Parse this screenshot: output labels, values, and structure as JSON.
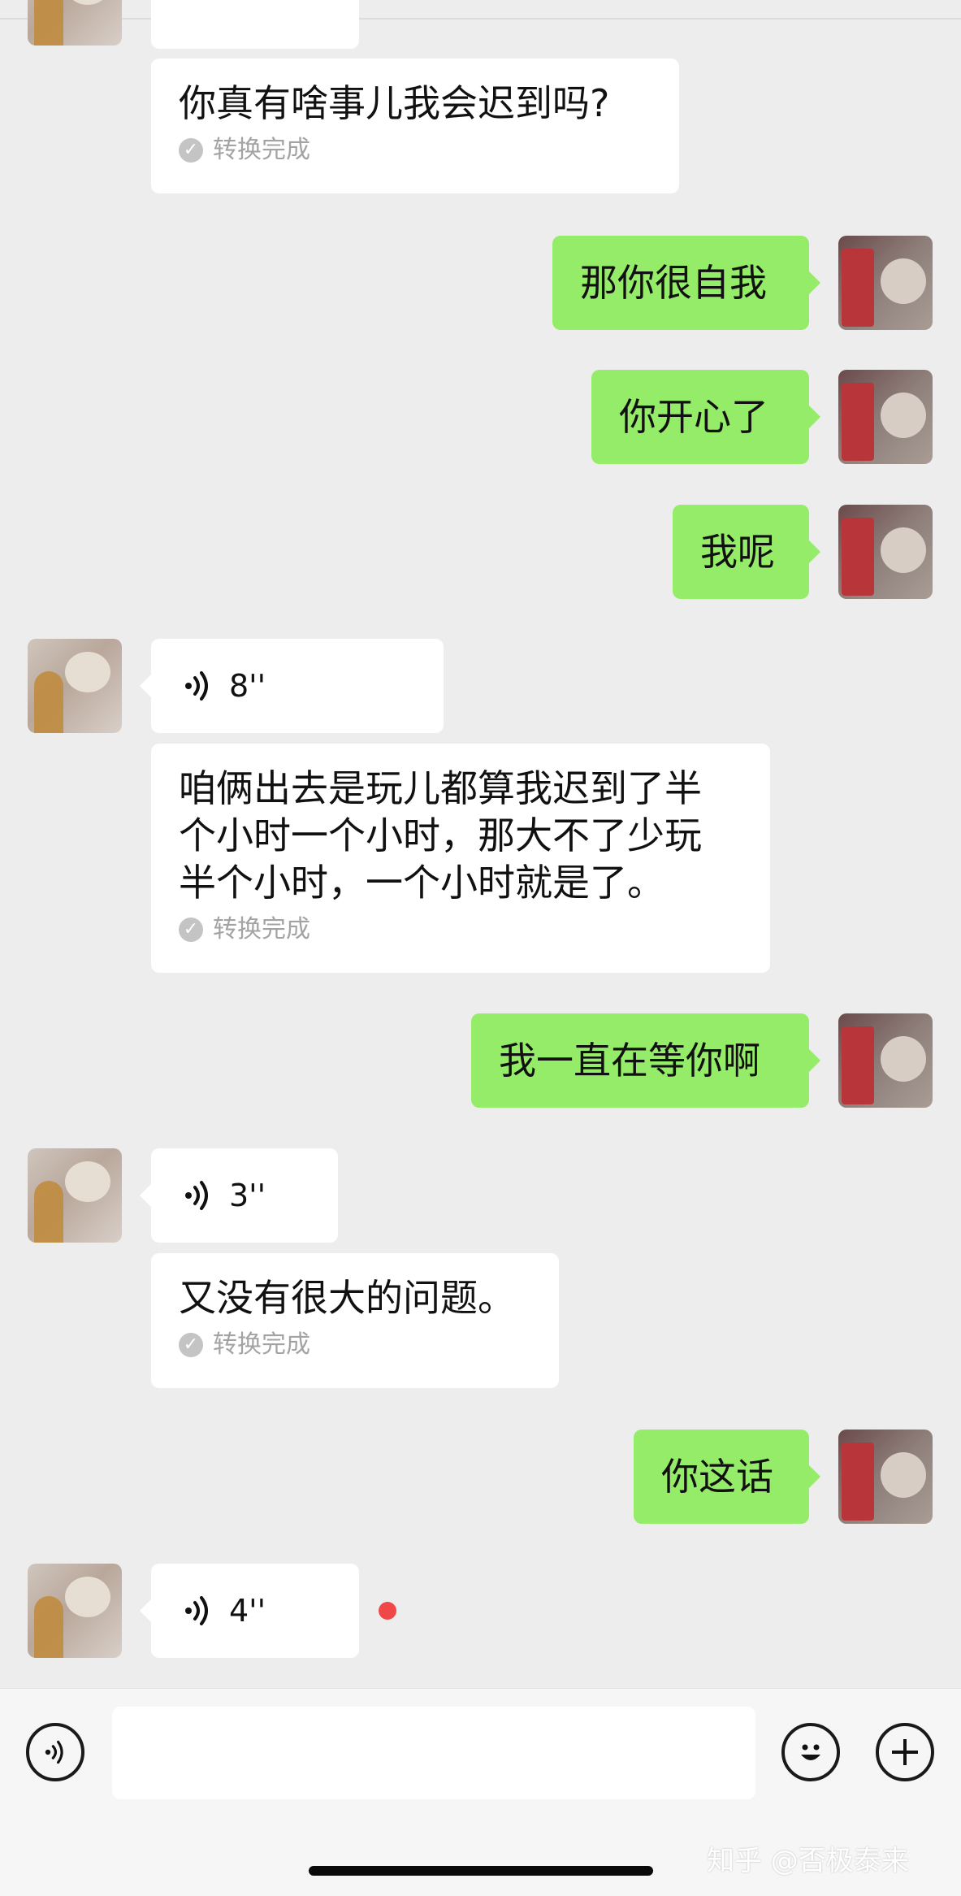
{
  "messages": [
    {
      "side": "left",
      "kind": "text",
      "text": "你真有啥事儿我会迟到吗?",
      "status": "转换完成"
    },
    {
      "side": "right",
      "kind": "text",
      "text": "那你很自我"
    },
    {
      "side": "right",
      "kind": "text",
      "text": "你开心了"
    },
    {
      "side": "right",
      "kind": "text",
      "text": "我呢"
    },
    {
      "side": "left",
      "kind": "voice",
      "duration": "8''"
    },
    {
      "side": "left",
      "kind": "text",
      "text": "咱俩出去是玩儿都算我迟到了半\n个小时一个小时，那大不了少玩\n半个小时，一个小时就是了。",
      "status": "转换完成"
    },
    {
      "side": "right",
      "kind": "text",
      "text": "我一直在等你啊"
    },
    {
      "side": "left",
      "kind": "voice",
      "duration": "3''"
    },
    {
      "side": "left",
      "kind": "text",
      "text": "又没有很大的问题。",
      "status": "转换完成"
    },
    {
      "side": "right",
      "kind": "text",
      "text": "你这话"
    },
    {
      "side": "left",
      "kind": "voice",
      "duration": "4''",
      "unread": true
    }
  ],
  "input_bar": {
    "voice_icon": "voice-icon",
    "emoji_icon": "emoji-icon",
    "plus_icon": "plus-icon"
  },
  "watermark": "知乎 @否极泰来",
  "colors": {
    "background": "#ededed",
    "self_bubble": "#95ec69",
    "other_bubble": "#ffffff",
    "unread_dot": "#f04848"
  }
}
